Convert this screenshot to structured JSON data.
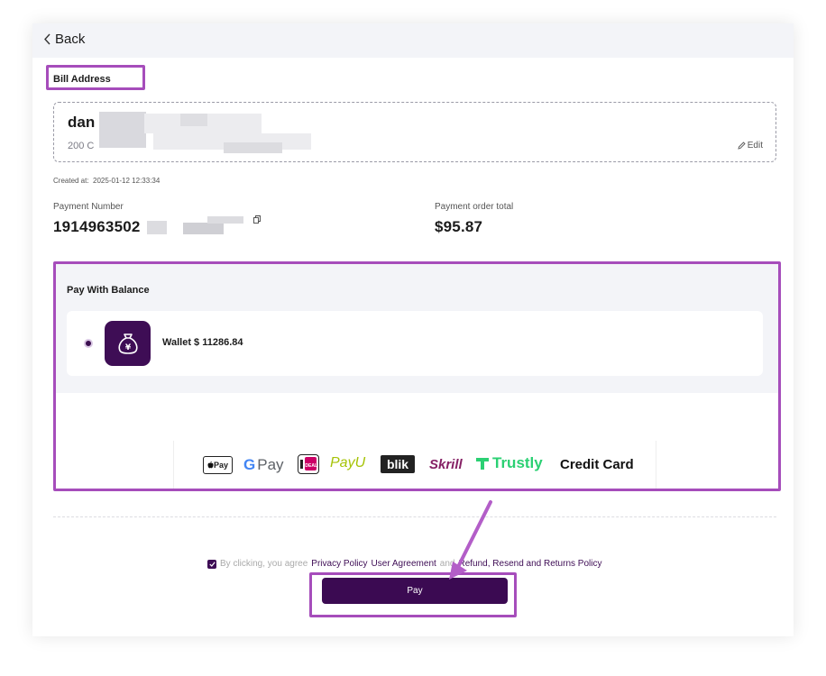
{
  "nav": {
    "back_label": "Back"
  },
  "bill": {
    "title": "Bill Address",
    "name": "dan",
    "address_line": "200 C",
    "edit_label": "Edit"
  },
  "order": {
    "created_label": "Created at:",
    "created_value": "2025-01-12 12:33:34",
    "payment_number_label": "Payment Number",
    "payment_number_value": "1914963502",
    "total_label": "Payment order total",
    "total_value": "$95.87"
  },
  "balance": {
    "title": "Pay With Balance",
    "wallet_label": "Wallet $ 11286.84"
  },
  "methods": {
    "apple_pay": "Pay",
    "google_pay": "Pay",
    "ideal": "iDEAL",
    "payu": "PayU",
    "blik": "blik",
    "skrill": "Skrill",
    "trustly": "Trustly",
    "credit_card": "Credit Card"
  },
  "agreement": {
    "prefix": "By clicking, you agree",
    "privacy": "Privacy Policy",
    "user_agreement": "User Agreement",
    "and": "and",
    "refund": "Refund, Resend and Returns Policy"
  },
  "pay_button": "Pay",
  "colors": {
    "brand": "#3b0a52",
    "highlight": "#a64dbb",
    "trustly": "#2bd073",
    "skrill": "#862165",
    "payu": "#a6c307",
    "google_blue": "#4285f4"
  }
}
